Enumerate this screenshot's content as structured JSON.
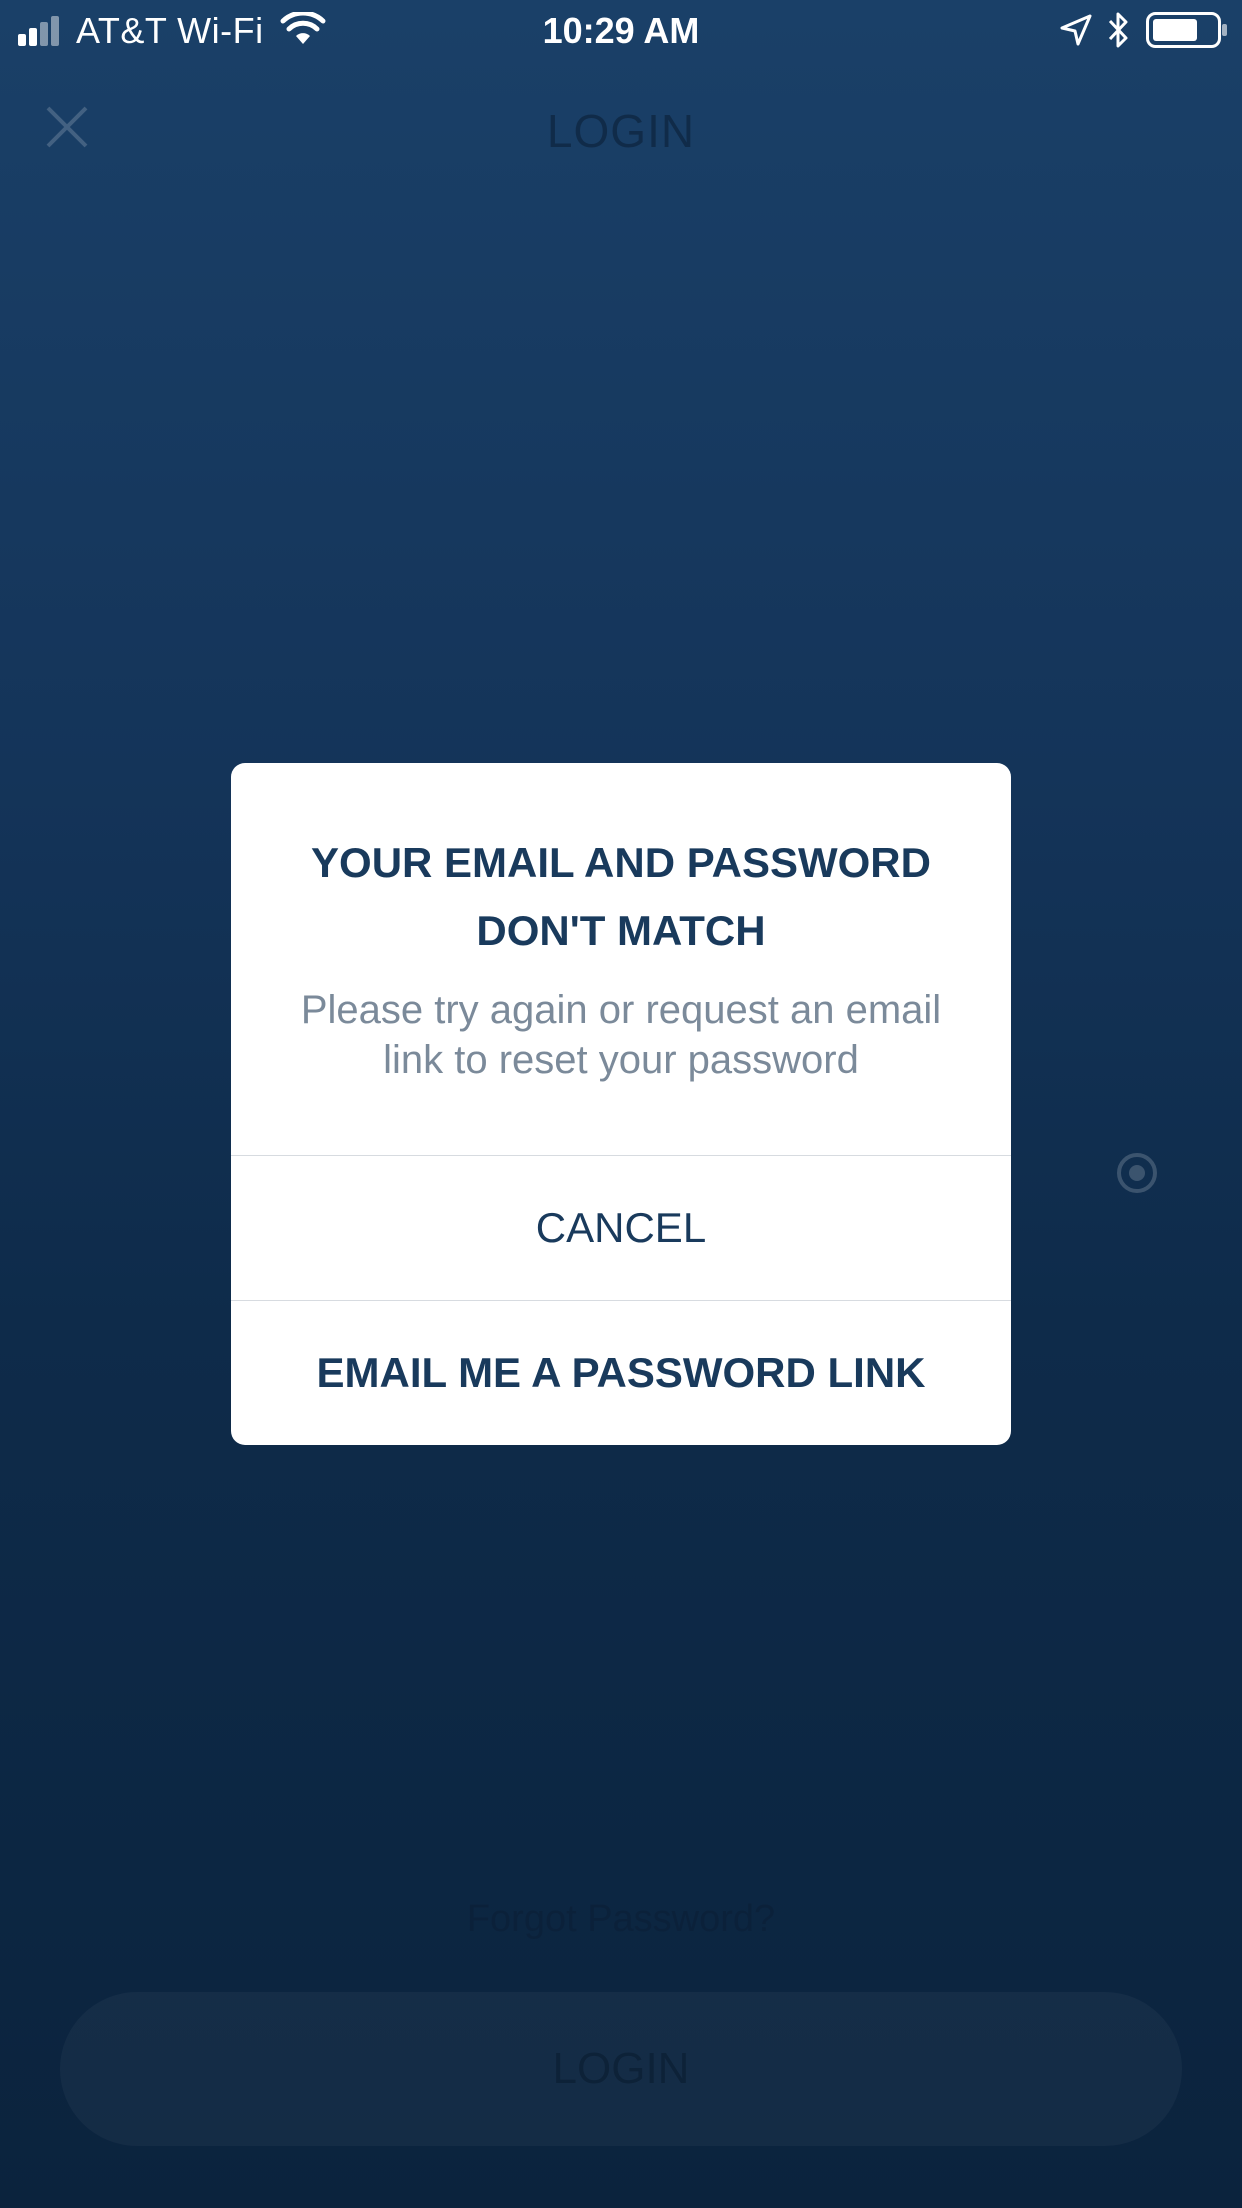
{
  "status_bar": {
    "carrier": "AT&T Wi-Fi",
    "time": "10:29 AM",
    "icons": [
      "signal-icon",
      "wifi-icon",
      "location-icon",
      "bluetooth-icon",
      "battery-icon"
    ]
  },
  "background": {
    "header_title": "LOGIN",
    "forgot_password": "Forgot Password?",
    "login_button": "LOGIN"
  },
  "dialog": {
    "title": "YOUR EMAIL AND PASSWORD DON'T MATCH",
    "message": "Please try again or request an email link to reset your password",
    "cancel_label": "CANCEL",
    "email_link_label": "EMAIL ME A PASSWORD LINK"
  },
  "colors": {
    "background_top": "#1a4068",
    "background_bottom": "#0b233d",
    "dialog_text": "#193a5c",
    "dialog_message": "#7b8a9a"
  }
}
